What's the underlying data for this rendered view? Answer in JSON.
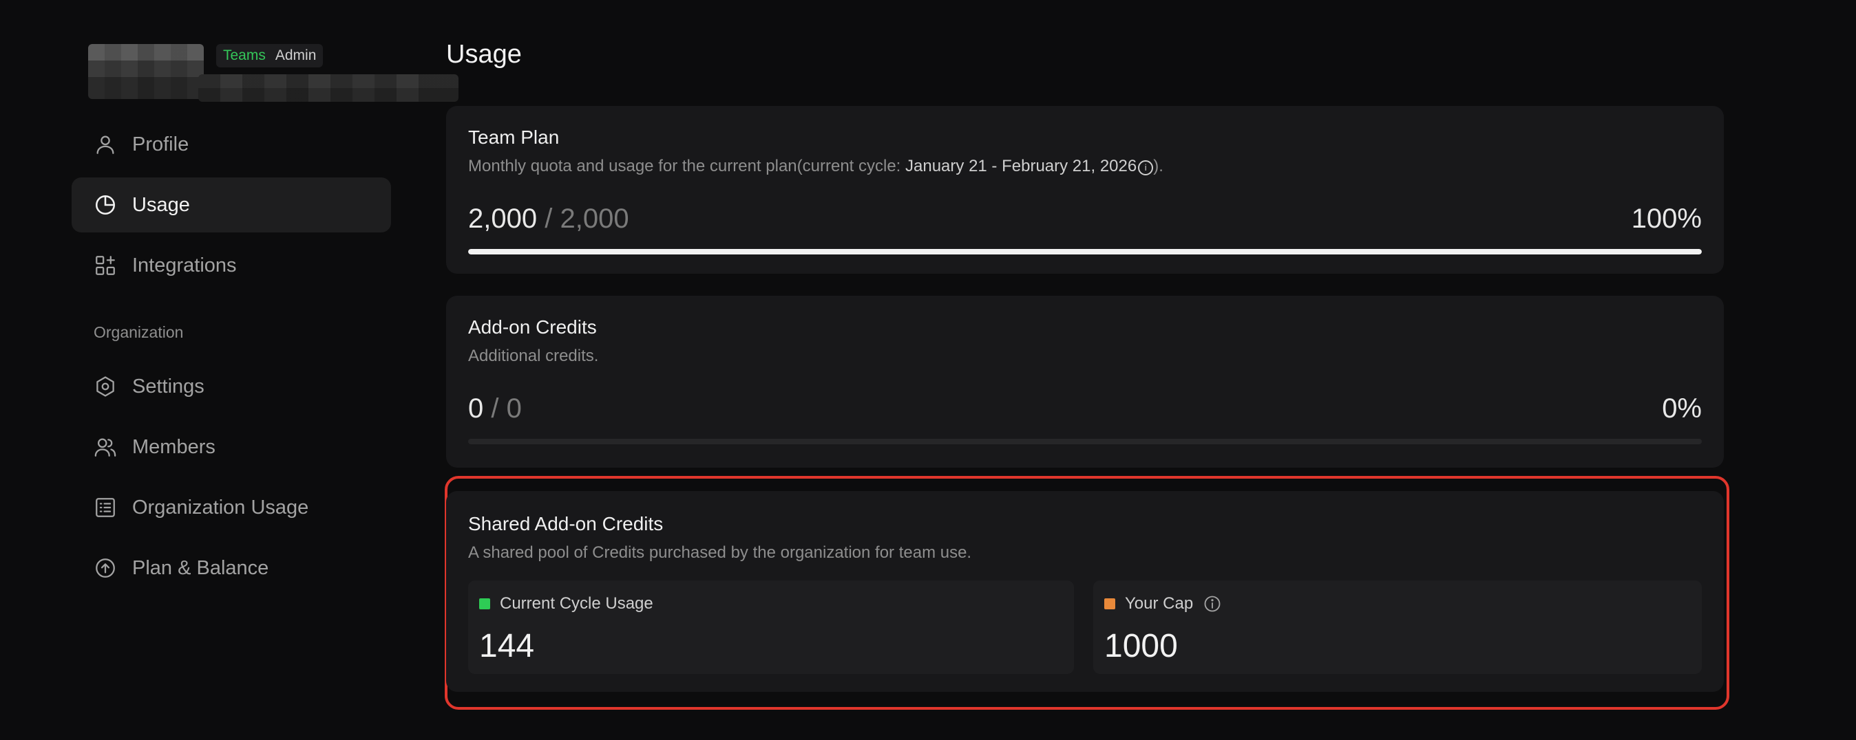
{
  "account": {
    "badge_teams": "Teams",
    "badge_admin": "Admin"
  },
  "sidebar": {
    "items": [
      {
        "label": "Profile",
        "icon": "user-icon"
      },
      {
        "label": "Usage",
        "icon": "pie-chart-icon",
        "active": true
      },
      {
        "label": "Integrations",
        "icon": "grid-plus-icon"
      }
    ],
    "section_label": "Organization",
    "org_items": [
      {
        "label": "Settings",
        "icon": "hexagon-gear-icon"
      },
      {
        "label": "Members",
        "icon": "users-icon"
      },
      {
        "label": "Organization Usage",
        "icon": "list-icon"
      },
      {
        "label": "Plan & Balance",
        "icon": "arrow-up-circle-icon"
      }
    ]
  },
  "main": {
    "title": "Usage",
    "team_plan": {
      "title": "Team Plan",
      "desc_prefix": "Monthly quota and usage for the current plan(current cycle: ",
      "cycle": "January 21 - February 21, 2026",
      "info_glyph": "i",
      "desc_suffix": ").",
      "used": "2,000",
      "total": "/ 2,000",
      "percent": "100%",
      "progress_fraction": 1.0
    },
    "addon_credits": {
      "title": "Add-on Credits",
      "desc": "Additional credits.",
      "used": "0",
      "total": "/ 0",
      "percent": "0%",
      "progress_fraction": 0.0
    },
    "shared_credits": {
      "title": "Shared Add-on Credits",
      "desc": "A shared pool of Credits purchased by the organization for team use.",
      "usage_label": "Current Cycle Usage",
      "usage_value": "144",
      "usage_color": "#2ecc55",
      "cap_label": "Your Cap",
      "cap_value": "1000",
      "cap_color": "#e8893a"
    }
  },
  "colors": {
    "background": "#0c0c0d",
    "card": "#18181a",
    "highlight": "#e0362c",
    "teams_badge": "#34c759"
  }
}
